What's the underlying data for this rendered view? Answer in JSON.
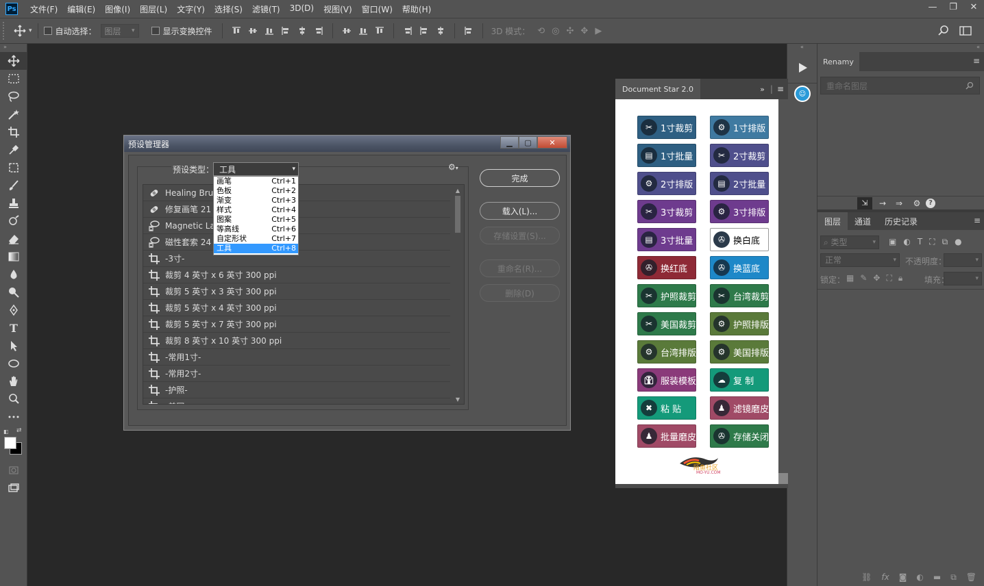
{
  "app": {
    "logo": "Ps"
  },
  "menubar": {
    "items": [
      "文件(F)",
      "编辑(E)",
      "图像(I)",
      "图层(L)",
      "文字(Y)",
      "选择(S)",
      "滤镜(T)",
      "3D(D)",
      "视图(V)",
      "窗口(W)",
      "帮助(H)"
    ]
  },
  "options": {
    "auto_select_label": "自动选择：",
    "auto_select_value": "图层",
    "show_transform_label": "显示变换控件",
    "mode_3d_label": "3D 模式："
  },
  "renamy": {
    "tab": "Renamy",
    "placeholder": "重命名图层"
  },
  "layers_panel": {
    "tabs": [
      "图层",
      "通道",
      "历史记录"
    ],
    "filter_label": "类型",
    "blend_mode": "正常",
    "opacity_label": "不透明度：",
    "lock_label": "锁定：",
    "fill_label": "填充："
  },
  "dstar": {
    "title": "Document Star 2.0",
    "buttons": [
      {
        "label": "1寸裁剪",
        "color": "#2e5f82",
        "icon": "scissors-icon"
      },
      {
        "label": "1寸排版",
        "color": "#3f7aa1",
        "icon": "gears-icon"
      },
      {
        "label": "1寸批量",
        "color": "#2e5f82",
        "icon": "chart-icon"
      },
      {
        "label": "2寸裁剪",
        "color": "#4f4f8c",
        "icon": "scissors-icon"
      },
      {
        "label": "2寸排版",
        "color": "#4f4f8c",
        "icon": "gears-icon"
      },
      {
        "label": "2寸批量",
        "color": "#4f4f8c",
        "icon": "chart-icon"
      },
      {
        "label": "3寸裁剪",
        "color": "#6e3b8e",
        "icon": "scissors-icon"
      },
      {
        "label": "3寸排版",
        "color": "#6e3b8e",
        "icon": "gears-icon"
      },
      {
        "label": "3寸批量",
        "color": "#6e3b8e",
        "icon": "chart-icon"
      },
      {
        "label": "换白底",
        "color": "#ffffff",
        "icon": "reel-icon"
      },
      {
        "label": "换红底",
        "color": "#8e2a36",
        "icon": "reel-icon"
      },
      {
        "label": "换蓝底",
        "color": "#1e88c8",
        "icon": "reel-icon"
      },
      {
        "label": "护照裁剪",
        "color": "#2e7a4a",
        "icon": "scissors-icon"
      },
      {
        "label": "台湾裁剪",
        "color": "#2e7a4a",
        "icon": "scissors-icon"
      },
      {
        "label": "美国裁剪",
        "color": "#2e7a4a",
        "icon": "scissors-icon"
      },
      {
        "label": "护照排版",
        "color": "#5a7a3a",
        "icon": "gears-icon"
      },
      {
        "label": "台湾排版",
        "color": "#5a7a3a",
        "icon": "gears-icon"
      },
      {
        "label": "美国排版",
        "color": "#5a7a3a",
        "icon": "gears-icon"
      },
      {
        "label": "服装模板",
        "color": "#8a3a7a",
        "icon": "suit-icon"
      },
      {
        "label": "复 制",
        "color": "#149a7a",
        "icon": "cloud-icon"
      },
      {
        "label": "粘 贴",
        "color": "#149a7a",
        "icon": "paste-icon"
      },
      {
        "label": "滤镜磨皮",
        "color": "#a04a66",
        "icon": "person-icon"
      },
      {
        "label": "批量磨皮",
        "color": "#a04a66",
        "icon": "person-icon"
      },
      {
        "label": "存储关闭",
        "color": "#2e7a4a",
        "icon": "save-icon"
      }
    ],
    "watermark_text": "陌鱼社区",
    "watermark_sub": "MO-YU.COM"
  },
  "dialog": {
    "title": "预设管理器",
    "preset_type_label": "预设类型：",
    "preset_type_value": "工具",
    "dropdown": [
      {
        "label": "画笔",
        "shortcut": "Ctrl+1"
      },
      {
        "label": "色板",
        "shortcut": "Ctrl+2"
      },
      {
        "label": "渐变",
        "shortcut": "Ctrl+3"
      },
      {
        "label": "样式",
        "shortcut": "Ctrl+4"
      },
      {
        "label": "图案",
        "shortcut": "Ctrl+5"
      },
      {
        "label": "等高线",
        "shortcut": "Ctrl+6"
      },
      {
        "label": "自定形状",
        "shortcut": "Ctrl+7"
      },
      {
        "label": "工具",
        "shortcut": "Ctrl+8"
      }
    ],
    "list": [
      {
        "label": "Healing Brush",
        "icon": "bandage-icon"
      },
      {
        "label": "修复画笔 21",
        "icon": "bandage-icon"
      },
      {
        "label": "Magnetic Lass",
        "icon": "magnetic-lasso-icon"
      },
      {
        "label": "磁性套索 24",
        "icon": "magnetic-lasso-icon"
      },
      {
        "label": "-3寸-",
        "icon": "crop-icon"
      },
      {
        "label": "裁剪 4 英寸 x 6 英寸 300 ppi",
        "icon": "crop-icon"
      },
      {
        "label": "裁剪 5 英寸 x 3 英寸 300 ppi",
        "icon": "crop-icon"
      },
      {
        "label": "裁剪 5 英寸 x 4 英寸 300 ppi",
        "icon": "crop-icon"
      },
      {
        "label": "裁剪 5 英寸 x 7 英寸 300 ppi",
        "icon": "crop-icon"
      },
      {
        "label": "裁剪 8 英寸 x 10 英寸 300 ppi",
        "icon": "crop-icon"
      },
      {
        "label": "-常用1寸-",
        "icon": "crop-icon"
      },
      {
        "label": "-常用2寸-",
        "icon": "crop-icon"
      },
      {
        "label": "-护照-",
        "icon": "crop-icon"
      },
      {
        "label": "-美国-",
        "icon": "crop-icon"
      }
    ],
    "btn_done": "完成",
    "btn_load": "载入(L)...",
    "btn_save": "存储设置(S)...",
    "btn_rename": "重命名(R)...",
    "btn_delete": "删除(D)"
  }
}
